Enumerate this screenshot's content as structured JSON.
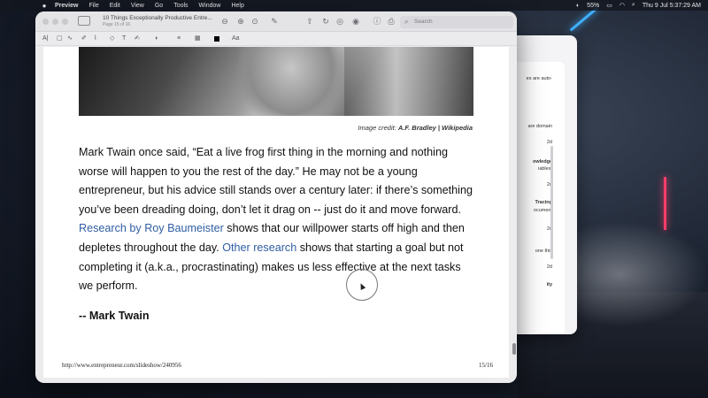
{
  "menubar": {
    "app_name": "Preview",
    "items": [
      "File",
      "Edit",
      "View",
      "Go",
      "Tools",
      "Window",
      "Help"
    ],
    "battery": "55%",
    "datetime": "Thu 9 Jul  5:37:29 AM"
  },
  "window": {
    "title": "10 Things Exceptionally Productive Entre...",
    "subtitle": "Page 15 of 16",
    "search_placeholder": "Search"
  },
  "back_window": {
    "texts": [
      "es are auto-",
      "are domain",
      "2d",
      "owledge",
      "iables,",
      "2d",
      "Tracing",
      "ocument",
      "2d",
      "one this",
      "2d",
      "ity"
    ]
  },
  "document": {
    "credit_prefix": "Image credit: ",
    "credit_name": "A.F. Bradley | Wikipedia",
    "paragraph_1": "Mark Twain once said, “Eat a live frog first thing in the morning and nothing worse will happen to you the rest of the day.” He may not be a young entrepreneur, but his advice still stands over a century later: if there’s something you’ve been dreading doing, don’t let it drag on -- just do it and move forward. ",
    "link_1": "Research by Roy Baumeister",
    "paragraph_2": " shows that our willpower starts off high and then depletes throughout the day. ",
    "link_2": "Other research",
    "paragraph_3": " shows that starting a goal but not completing it (a.k.a., procrastinating) makes us less effective at the next tasks we perform.",
    "quote_author": "-- Mark Twain",
    "footer_url": "http://www.entrepreneur.com/slideshow/240956",
    "footer_page": "15/16"
  },
  "icons": {
    "apple": "",
    "wifi": "wifi-icon",
    "battery": "battery-icon"
  }
}
